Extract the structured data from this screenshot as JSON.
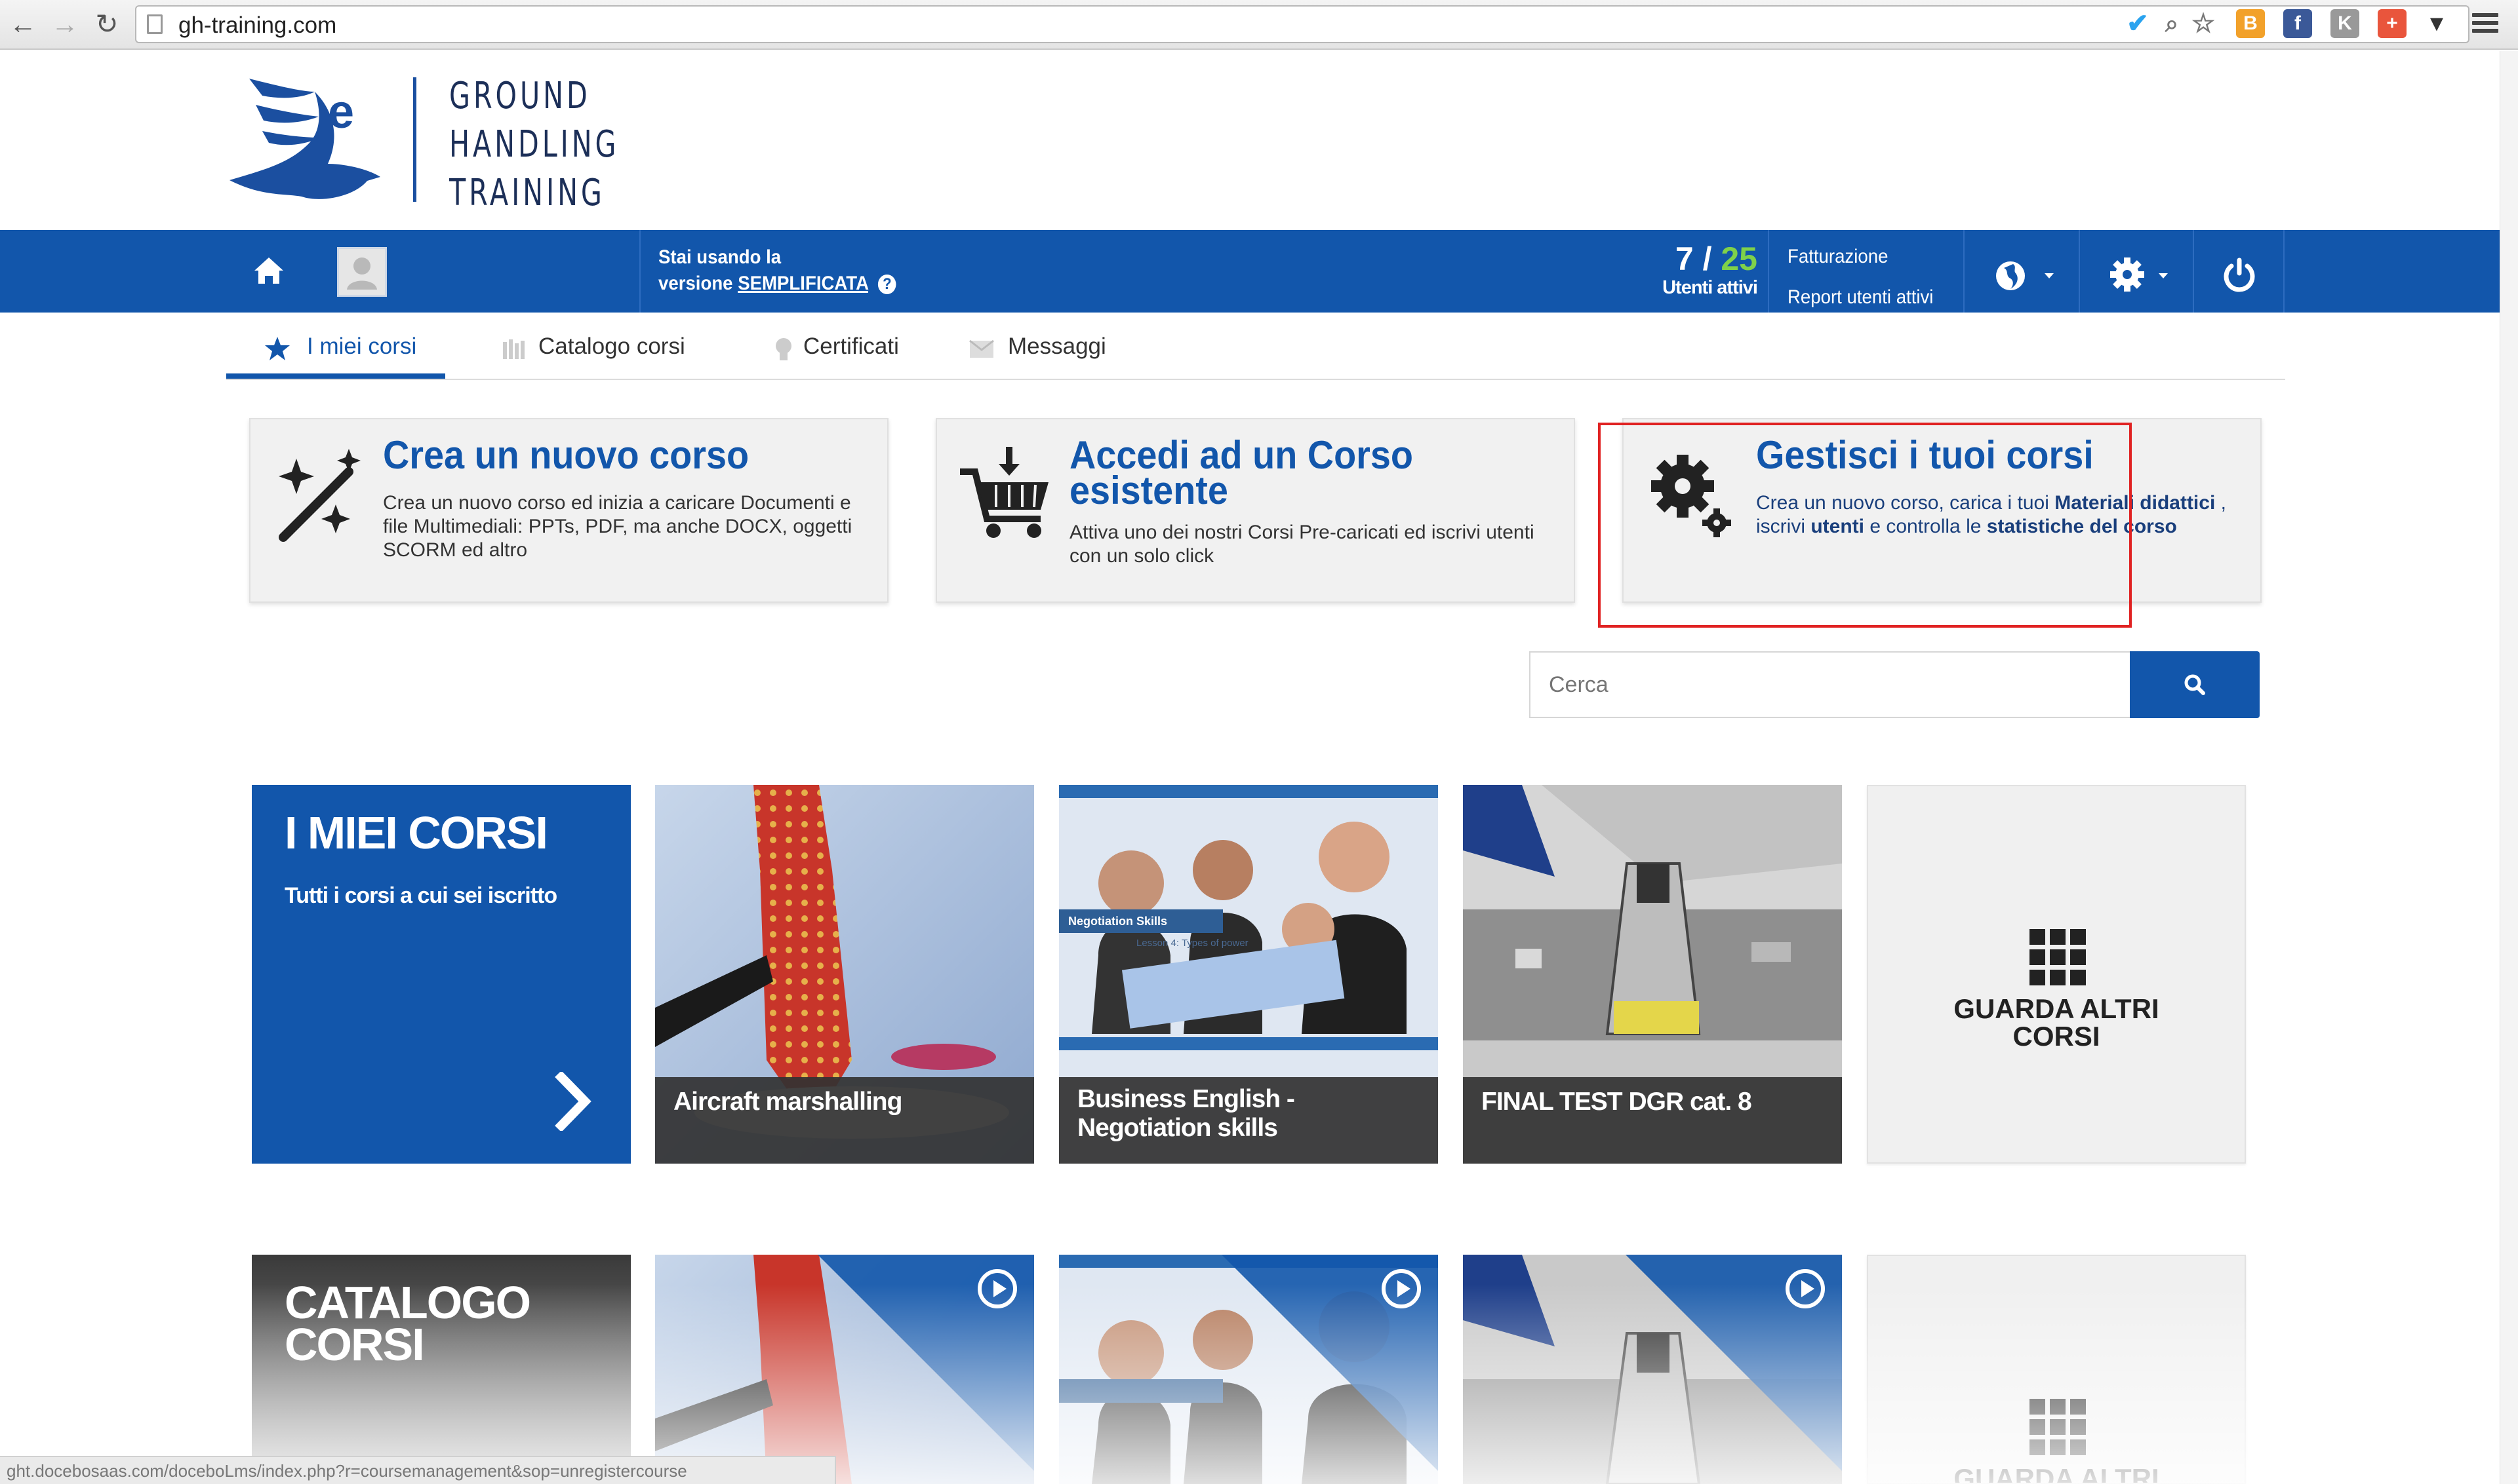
{
  "browser": {
    "url": "gh-training.com",
    "back_icon": "arrow-left-icon",
    "forward_icon": "arrow-right-icon",
    "reload_icon": "reload-icon",
    "extensions": [
      "twitter-icon",
      "zoom-icon",
      "star-icon",
      "blogger-icon",
      "facebook-icon",
      "k-icon",
      "plus-icon",
      "bird-icon"
    ],
    "status_url": "ght.docebosaas.com/doceboLms/index.php?r=coursemanagement&sop=unregistercourse"
  },
  "logo": {
    "letter": "e",
    "lines": [
      "GROUND",
      "HANDLING",
      "TRAINING"
    ],
    "color": "#1c2f58"
  },
  "topbar": {
    "version_line1": "Stai usando la",
    "version_prefix": "versione",
    "version_link": "SEMPLIFICATA",
    "help": "?",
    "users_active": "7",
    "users_sep": "/",
    "users_total": "25",
    "users_label": "Utenti attivi",
    "billing": "Fatturazione",
    "report": "Report utenti attivi",
    "accent": "#1256ab",
    "total_color": "#7fd14a"
  },
  "tabs": [
    {
      "label": "I miei corsi",
      "icon": "star-icon",
      "active": true
    },
    {
      "label": "Catalogo corsi",
      "icon": "catalog-icon",
      "active": false
    },
    {
      "label": "Certificati",
      "icon": "certificate-icon",
      "active": false
    },
    {
      "label": "Messaggi",
      "icon": "envelope-icon",
      "active": false
    }
  ],
  "cards": {
    "create": {
      "title": "Crea un nuovo corso",
      "desc": "Crea un nuovo corso ed inizia a caricare Documenti e file Multimediali: PPTs, PDF, ma anche DOCX, oggetti SCORM ed altro",
      "icon": "magic-wand-icon"
    },
    "access": {
      "title1": "Accedi ad un Corso",
      "title2": "esistente",
      "desc": "Attiva uno dei nostri Corsi Pre-caricati ed iscrivi utenti con un solo click",
      "icon": "cart-icon"
    },
    "manage": {
      "title": "Gestisci i tuoi corsi",
      "desc_a": "Crea un nuovo corso, carica i tuoi ",
      "desc_b": "Materiali didattici",
      "desc_c": " , iscrivi ",
      "desc_d": "utenti",
      "desc_e": " e controlla le ",
      "desc_f": "statistiche del corso",
      "icon": "gears-icon"
    }
  },
  "search": {
    "placeholder": "Cerca",
    "icon": "search-icon"
  },
  "my_courses": {
    "heading": "I MIEI CORSI",
    "subheading": "Tutti i corsi a cui sei iscritto",
    "arrow": "chevron-right-icon"
  },
  "courses": [
    {
      "title": "Aircraft marshalling"
    },
    {
      "title": "Business English - Negotiation skills",
      "lesson_tag": "Negotiation Skills",
      "lesson_sub": "Lesson 4: Types of power"
    },
    {
      "title": "FINAL TEST DGR cat. 8"
    }
  ],
  "more": {
    "label1": "GUARDA ALTRI",
    "label2": "CORSI",
    "icon": "grid-icon"
  },
  "catalog": {
    "heading1": "CATALOGO",
    "heading2": "CORSI"
  }
}
